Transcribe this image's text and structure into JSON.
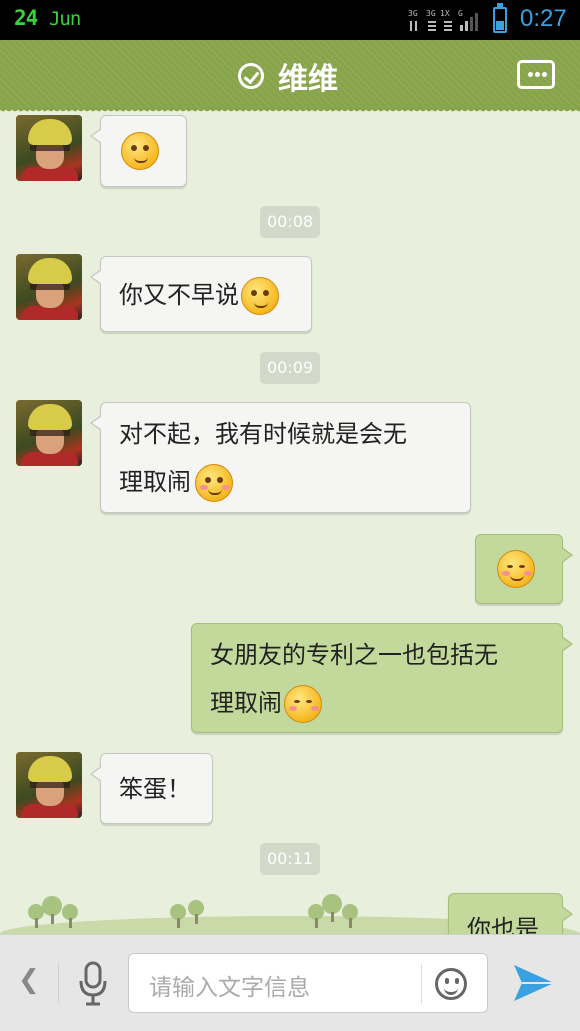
{
  "status": {
    "date_day": "24",
    "date_month": "Jun",
    "time": "0:27"
  },
  "header": {
    "title": "维维"
  },
  "messages": [
    {
      "side": "left",
      "text": ""
    },
    {
      "side": "left",
      "text": "你又不早说"
    },
    {
      "side": "left",
      "text": "对不起，我有时候就是会无",
      "text2": "理取闹"
    },
    {
      "side": "right",
      "text": ""
    },
    {
      "side": "right",
      "text": "女朋友的专利之一也包括无",
      "text2": "理取闹"
    },
    {
      "side": "left",
      "text": "笨蛋！"
    },
    {
      "side": "right",
      "text": "你也是"
    }
  ],
  "timestamps": [
    "00:08",
    "00:09",
    "00:11"
  ],
  "input": {
    "placeholder": "请输入文字信息"
  },
  "colors": {
    "header": "#87a44a",
    "background": "#e8efdc",
    "bubble_self": "#c2d99b",
    "bubble_other": "#f5f5f3",
    "accent": "#3aa0e0"
  }
}
